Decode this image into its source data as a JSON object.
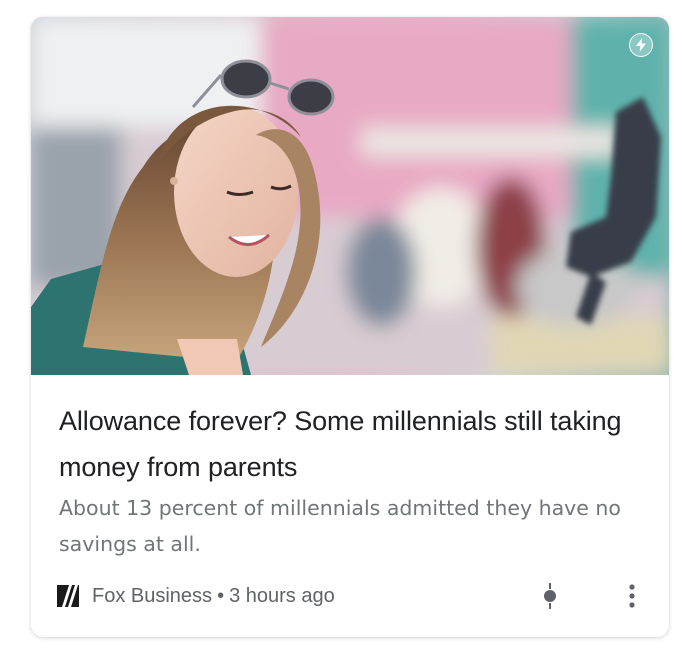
{
  "article": {
    "headline": "Allowance forever? Some millennials still taking money from parents",
    "snippet": "About 13 percent of millennials admitted they have no savings at all.",
    "source": "Fox Business",
    "separator": "•",
    "time": "3 hours ago"
  },
  "icons": {
    "amp_badge": "lightning-bolt-icon",
    "source_logo": "fox-business-logo",
    "action": "developing-story-icon",
    "menu": "more-vert-icon"
  },
  "colors": {
    "headline": "#202124",
    "snippet": "#70757a",
    "meta": "#5f6368",
    "card_background": "#ffffff"
  }
}
